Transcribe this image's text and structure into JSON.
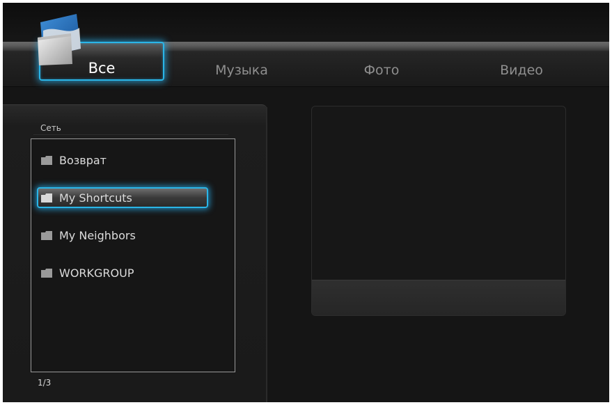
{
  "tabs": [
    {
      "label": "Все",
      "active": true
    },
    {
      "label": "Музыка",
      "active": false
    },
    {
      "label": "Фото",
      "active": false
    },
    {
      "label": "Видео",
      "active": false
    }
  ],
  "browser": {
    "title": "Сеть",
    "items": [
      {
        "label": "Возврат",
        "icon": "folder-icon",
        "selected": false
      },
      {
        "label": "My Shortcuts",
        "icon": "folder-icon",
        "selected": true
      },
      {
        "label": "My Neighbors",
        "icon": "folder-icon",
        "selected": false
      },
      {
        "label": "WORKGROUP",
        "icon": "folder-icon",
        "selected": false
      }
    ],
    "page": "1/3"
  },
  "header_icon": "folder-icon",
  "colors": {
    "accent": "#2ab6e8",
    "background": "#151515",
    "text": "#dcdcdc",
    "inactive_tab": "#8f8f8f"
  }
}
